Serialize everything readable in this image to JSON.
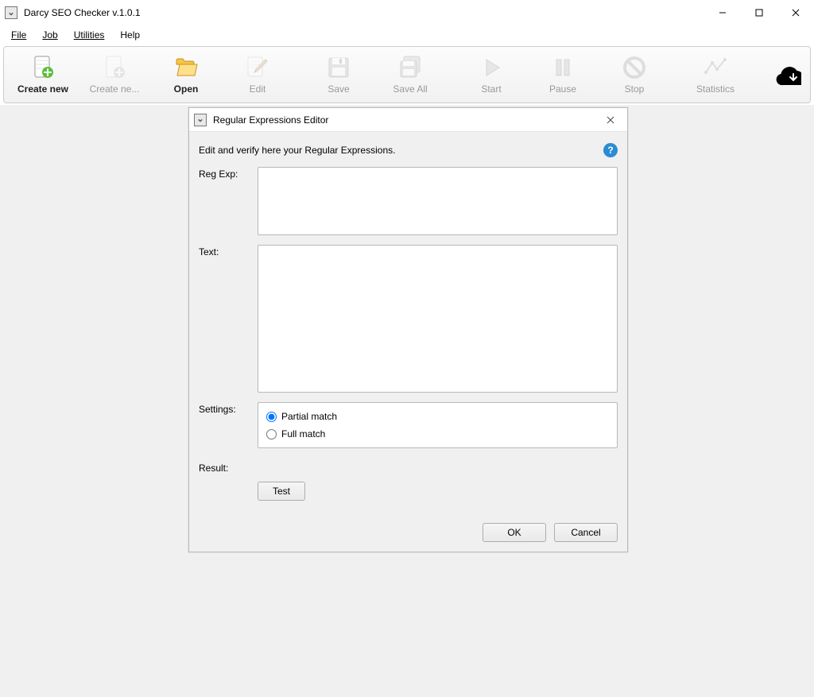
{
  "app": {
    "title": "Darcy SEO Checker v.1.0.1"
  },
  "menubar": {
    "file": "File",
    "job": "Job",
    "utilities": "Utilities",
    "help": "Help"
  },
  "toolbar": {
    "create_new": "Create new",
    "create_net": "Create ne...",
    "open": "Open",
    "edit": "Edit",
    "save": "Save",
    "save_all": "Save All",
    "start": "Start",
    "pause": "Pause",
    "stop": "Stop",
    "statistics": "Statistics"
  },
  "modal": {
    "title": "Regular Expressions Editor",
    "subtext": "Edit and verify here your Regular Expressions.",
    "labels": {
      "regexp": "Reg Exp:",
      "text": "Text:",
      "settings": "Settings:",
      "result": "Result:"
    },
    "settings": {
      "partial": "Partial match",
      "full": "Full match"
    },
    "buttons": {
      "test": "Test",
      "ok": "OK",
      "cancel": "Cancel"
    },
    "values": {
      "regexp": "",
      "text": "",
      "result": ""
    }
  }
}
